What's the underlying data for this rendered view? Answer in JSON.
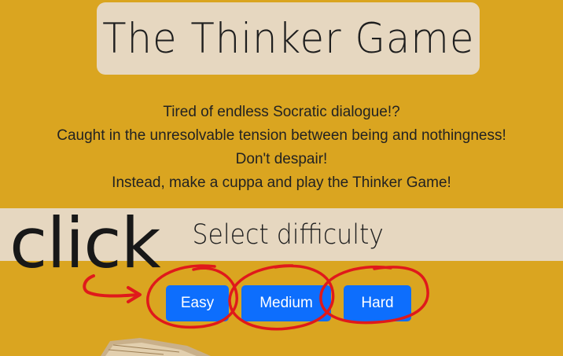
{
  "header": {
    "title": "The Thinker Game"
  },
  "intro": {
    "lines": [
      "Tired of endless Socratic dialogue!?",
      "Caught in the unresolvable tension between being and nothingness!",
      "Don't despair!",
      "Instead, make a cuppa and play the Thinker Game!"
    ]
  },
  "difficulty": {
    "heading": "Select difficulty",
    "buttons": {
      "easy": "Easy",
      "medium": "Medium",
      "hard": "Hard"
    }
  },
  "annotation": {
    "text": "click"
  },
  "colors": {
    "background": "#DAA520",
    "panel": "#E6D7C0",
    "button": "#0D6EFD",
    "annotation_red": "#E0191B"
  }
}
